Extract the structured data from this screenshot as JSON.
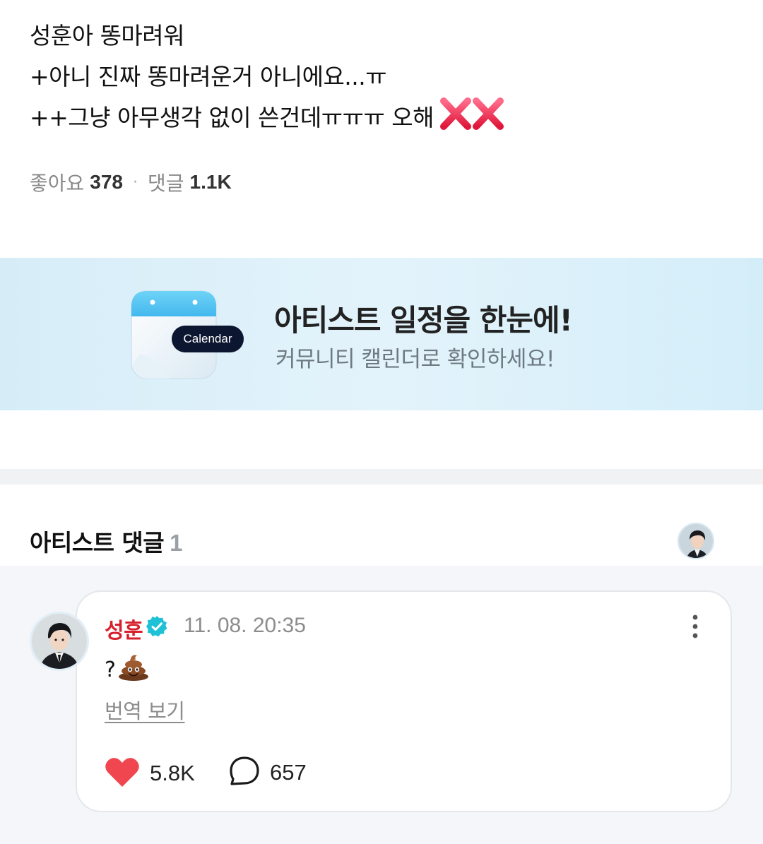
{
  "post": {
    "lines": [
      "성훈아 똥마려워",
      "+아니 진짜 똥마려운거 아니에요...ㅠ",
      "++그냥 아무생각 없이 쓴건데ㅠㅠㅠ 오해"
    ],
    "emoji_icon": "cross-mark-icon",
    "likes_label": "좋아요",
    "likes_count": "378",
    "comments_label": "댓글",
    "comments_count": "1.1K"
  },
  "banner": {
    "tag": "Calendar",
    "title": "아티스트 일정을 한눈에!",
    "subtitle": "커뮤니티 캘린더로 확인하세요!"
  },
  "artist_comments": {
    "header": "아티스트 댓글",
    "count": "1"
  },
  "comment": {
    "author": "성훈",
    "timestamp": "11. 08. 20:35",
    "text": "?",
    "text_icon": "poop-icon",
    "translate_label": "번역 보기",
    "likes": "5.8K",
    "replies": "657"
  },
  "colors": {
    "author_name": "#d6202c",
    "verified_badge": "#1fc1d6",
    "heart": "#f0464f"
  }
}
